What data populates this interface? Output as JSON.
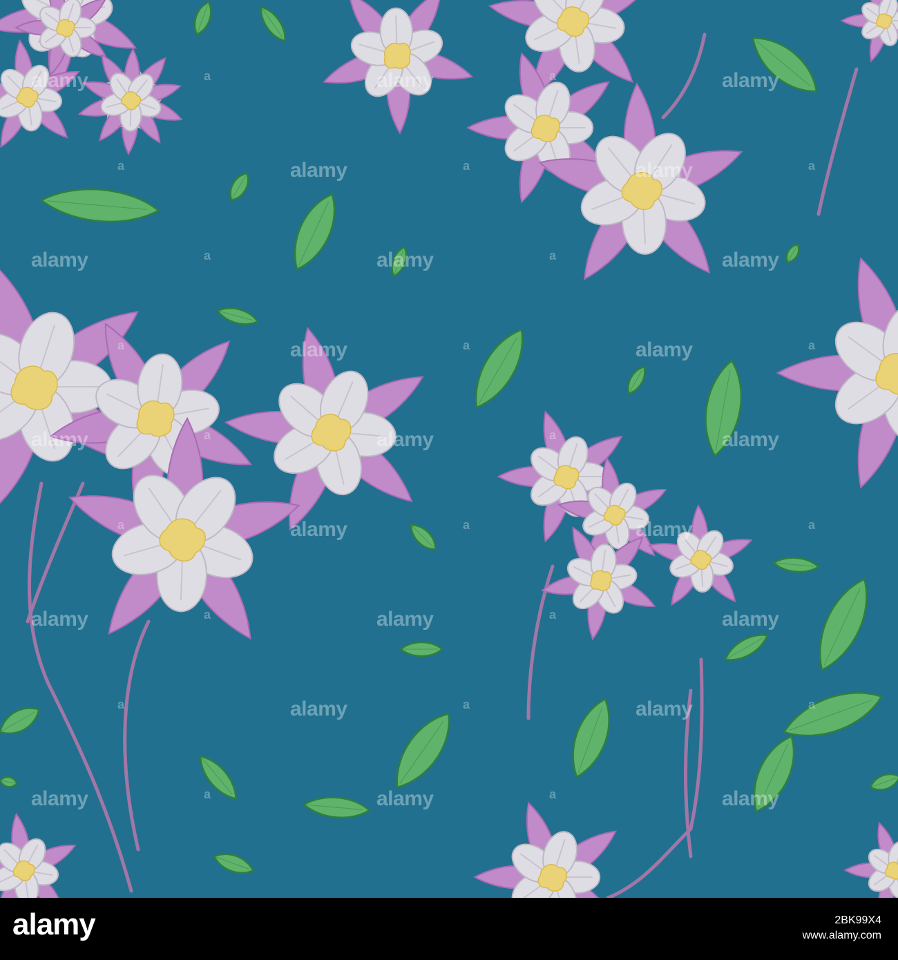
{
  "image": {
    "description_colors": {
      "background": "#21708f",
      "petal_outer": "#c18ac8",
      "petal_outer_dark": "#a96bb3",
      "petal_inner": "#dfdde4",
      "petal_inner_shade": "#bdb9c6",
      "center": "#ead376",
      "leaf": "#5fb36a",
      "leaf_edge": "#2f7f3e",
      "stem": "#a277a6"
    }
  },
  "watermark": {
    "text": "alamy",
    "small_text": "a"
  },
  "footer": {
    "logo": "alamy",
    "image_id": "2BK99X4",
    "url": "www.alamy.com"
  }
}
